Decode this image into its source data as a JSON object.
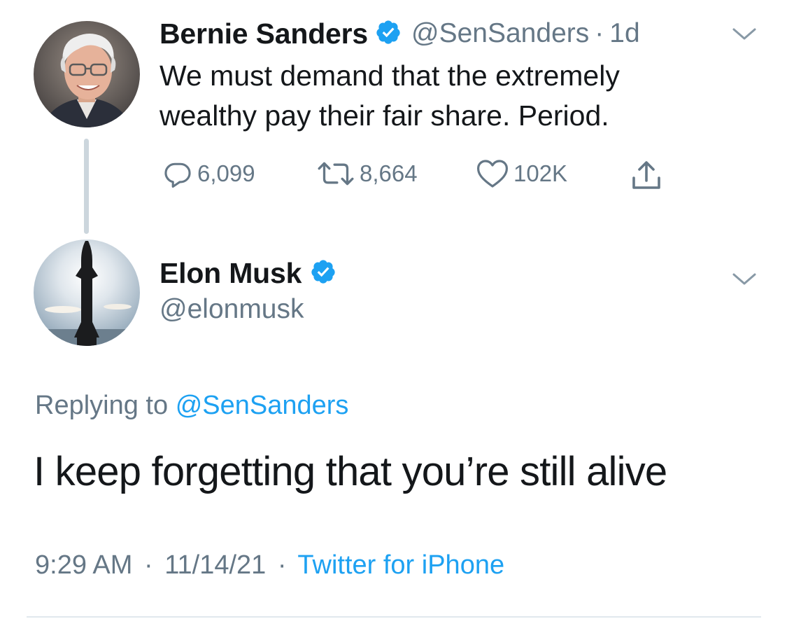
{
  "parent_tweet": {
    "author_name": "Bernie Sanders",
    "handle": "@SenSanders",
    "separator": "·",
    "age": "1d",
    "verified": true,
    "avatar_icon": "person-avatar",
    "text_line1": "We must demand that the extremely",
    "text_line2": "wealthy pay their fair share. Period.",
    "actions": {
      "replies": "6,099",
      "retweets": "8,664",
      "likes": "102K"
    }
  },
  "reply_tweet": {
    "author_name": "Elon Musk",
    "handle": "@elonmusk",
    "verified": true,
    "avatar_icon": "rocket-avatar",
    "replying_prefix": "Replying to",
    "replying_to": "@SenSanders",
    "text": "I keep forgetting that you’re still alive",
    "time": "9:29 AM",
    "date": "11/14/21",
    "separator": "·",
    "source": "Twitter for iPhone"
  },
  "colors": {
    "accent": "#1da1f2",
    "text_primary": "#14171a",
    "text_secondary": "#657786",
    "thread_line": "#ccd6dd"
  }
}
